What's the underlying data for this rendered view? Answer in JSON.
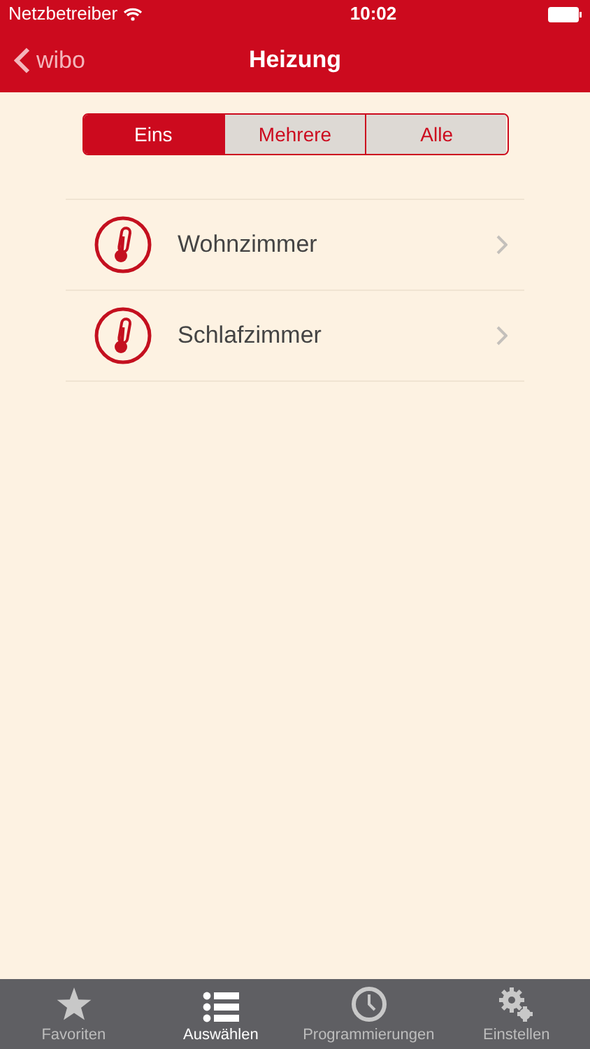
{
  "status_bar": {
    "carrier": "Netzbetreiber",
    "time": "10:02"
  },
  "nav": {
    "back": "wibo",
    "title": "Heizung"
  },
  "segments": [
    {
      "label": "Eins",
      "selected": true
    },
    {
      "label": "Mehrere",
      "selected": false
    },
    {
      "label": "Alle",
      "selected": false
    }
  ],
  "rooms": [
    {
      "name": "Wohnzimmer"
    },
    {
      "name": "Schlafzimmer"
    }
  ],
  "tab_bar": [
    {
      "label": "Favoriten",
      "kind": "star",
      "selected": false
    },
    {
      "label": "Auswählen",
      "kind": "list",
      "selected": true
    },
    {
      "label": "Programmierungen",
      "kind": "clock",
      "selected": false
    },
    {
      "label": "Einstellen",
      "kind": "gears",
      "selected": false
    }
  ]
}
